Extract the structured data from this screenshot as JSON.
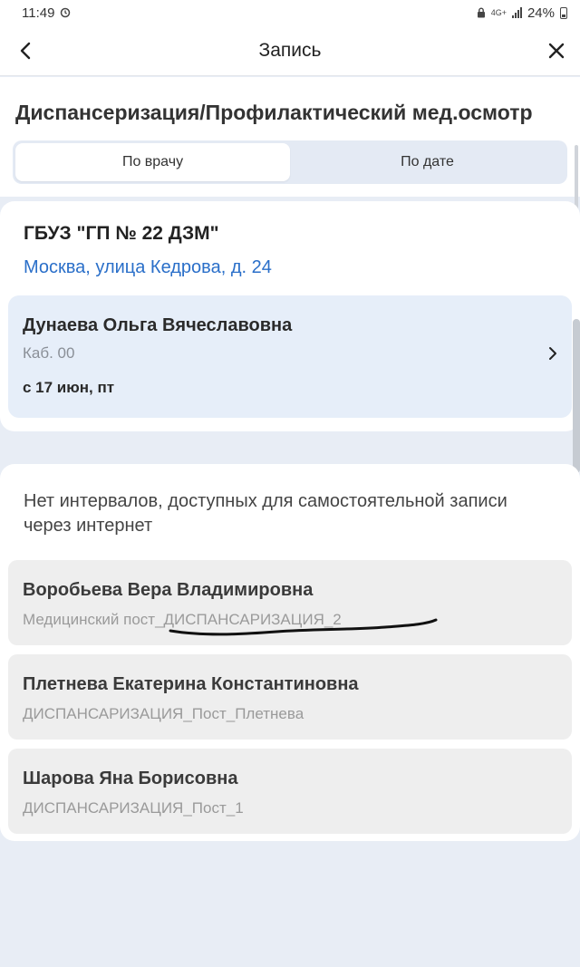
{
  "status_bar": {
    "time": "11:49",
    "network": "4G+",
    "battery": "24%"
  },
  "header": {
    "title": "Запись"
  },
  "service": {
    "title": "Диспансеризация/Профилактический мед.осмотр"
  },
  "tabs": [
    {
      "label": "По врачу",
      "active": true
    },
    {
      "label": "По дате",
      "active": false
    }
  ],
  "clinic": {
    "name": "ГБУЗ \"ГП № 22 ДЗМ\"",
    "address": "Москва, улица Кедрова, д. 24",
    "doctor": {
      "name": "Дунаева Ольга Вячеславовна",
      "room": "Каб. 00",
      "date": "с 17 июн, пт"
    }
  },
  "unavailable": {
    "notice": "Нет интервалов, доступных для самостоятельной записи через интернет",
    "items": [
      {
        "name": "Воробьева Вера Владимировна",
        "post": "Медицинский пост_ДИСПАНСАРИЗАЦИЯ_2"
      },
      {
        "name": "Плетнева Екатерина Константиновна",
        "post": "ДИСПАНСАРИЗАЦИЯ_Пост_Плетнева"
      },
      {
        "name": "Шарова Яна Борисовна",
        "post": "ДИСПАНСАРИЗАЦИЯ_Пост_1"
      }
    ]
  },
  "colors": {
    "accent_link": "#2a6fc9",
    "doctor_card_bg": "#e6eef9",
    "page_bg": "#e8edf5"
  }
}
